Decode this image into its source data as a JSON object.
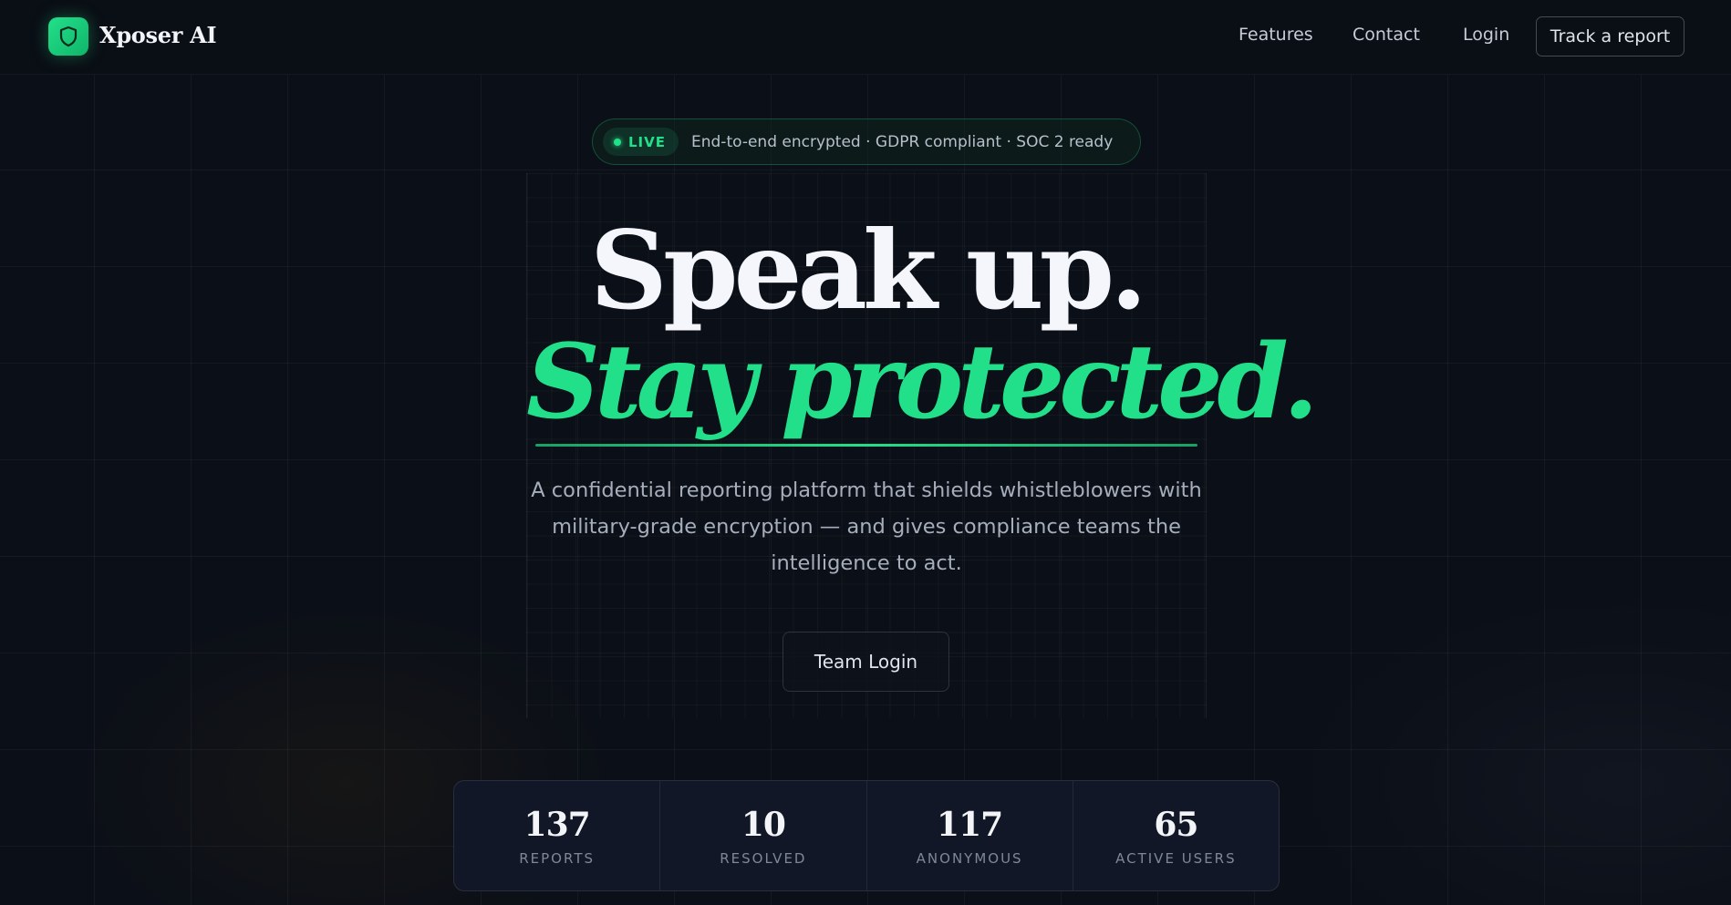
{
  "header": {
    "brand": "Xposer AI",
    "nav": [
      "Features",
      "Contact",
      "Login"
    ],
    "cta": "Track a report"
  },
  "hero": {
    "badge_label": "LIVE",
    "badge_text": "End-to-end encrypted · GDPR compliant · SOC 2 ready",
    "headline": "Speak up.",
    "headline_accent": "Stay protected.",
    "subtitle": "A confidential reporting platform that shields whistleblowers with military-grade encryption — and gives compliance teams the intelligence to act.",
    "button": "Team Login"
  },
  "stats": [
    {
      "value": "137",
      "label": "REPORTS"
    },
    {
      "value": "10",
      "label": "RESOLVED"
    },
    {
      "value": "117",
      "label": "ANONYMOUS"
    },
    {
      "value": "65",
      "label": "ACTIVE USERS"
    }
  ],
  "colors": {
    "accent": "#22e08a",
    "background": "#0b0f17"
  },
  "icons": {
    "logo": "shield-icon"
  }
}
